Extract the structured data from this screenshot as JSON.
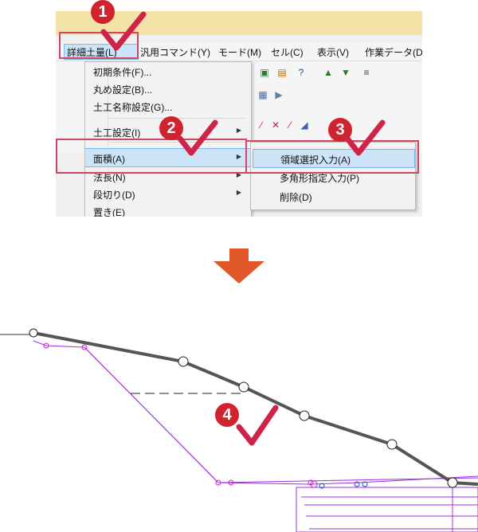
{
  "menubar": {
    "items": [
      "詳細土量(L)",
      "汎用コマンド(Y)",
      "モード(M)",
      "セル(C)",
      "表示(V)",
      "作業データ(D"
    ]
  },
  "menu": {
    "items": [
      {
        "label": "初期条件(F)..."
      },
      {
        "label": "丸め設定(B)..."
      },
      {
        "label": "土工名称設定(G)..."
      },
      {
        "label": "土工設定(I)"
      },
      {
        "label": "面積(A)"
      },
      {
        "label": "法長(N)"
      },
      {
        "label": "段切り(D)"
      },
      {
        "label": "置き(E)"
      }
    ]
  },
  "submenu": {
    "items": [
      {
        "label": "領域選択入力(A)"
      },
      {
        "label": "多角形指定入力(P)"
      },
      {
        "label": "削除(D)"
      }
    ]
  },
  "steps": [
    "1",
    "2",
    "3",
    "4"
  ],
  "colors": {
    "badge": "#d0232e",
    "check": "#cf2448",
    "highlight_box": "#d0455f",
    "arrow": "#e0582a",
    "ground_line": "#555555",
    "design_line": "#9b30e0"
  },
  "icons": [
    "down-arrow-icon",
    "checkmark-icon",
    "submenu-arrow-icon",
    "toolbar-icon"
  ]
}
